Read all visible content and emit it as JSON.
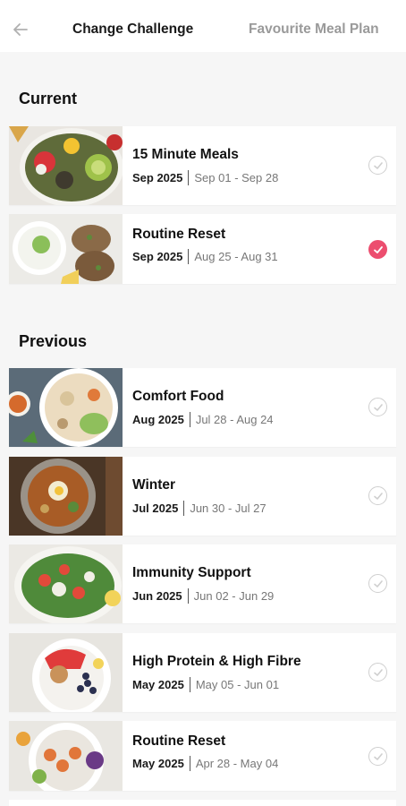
{
  "header": {
    "back_icon": "arrow-left-icon",
    "tab_active": "Change Challenge",
    "tab_inactive": "Favourite Meal Plan"
  },
  "sections": {
    "current": "Current",
    "previous": "Previous"
  },
  "colors": {
    "accent": "#ec4e6f",
    "check_off": "#cfcfcf"
  },
  "current": [
    {
      "title": "15 Minute Meals",
      "month": "Sep 2025",
      "range": "Sep 01 - Sep 28",
      "selected": false
    },
    {
      "title": "Routine Reset",
      "month": "Sep 2025",
      "range": "Aug 25 - Aug 31",
      "selected": true
    }
  ],
  "previous": [
    {
      "title": "Comfort Food",
      "month": "Aug 2025",
      "range": "Jul 28 - Aug 24",
      "selected": false
    },
    {
      "title": "Winter",
      "month": "Jul 2025",
      "range": "Jun 30 - Jul 27",
      "selected": false
    },
    {
      "title": "Immunity Support",
      "month": "Jun 2025",
      "range": "Jun 02 - Jun 29",
      "selected": false
    },
    {
      "title": "High Protein & High Fibre",
      "month": "May 2025",
      "range": "May 05 - Jun 01",
      "selected": false
    },
    {
      "title": "Routine Reset",
      "month": "May 2025",
      "range": "Apr 28 - May 04",
      "selected": false
    }
  ]
}
